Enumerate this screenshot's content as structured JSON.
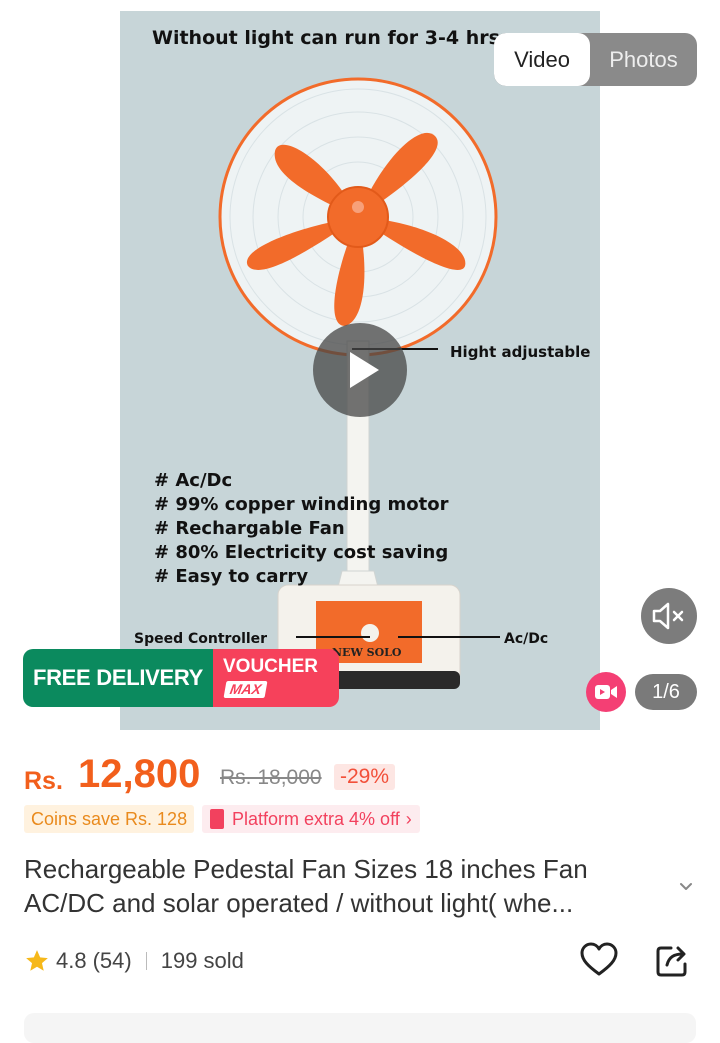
{
  "media": {
    "photo": {
      "caption_top": "Without light can run for 3-4 hrs",
      "hight_label": "Hight adjustable",
      "features": [
        "# Ac/Dc",
        "# 99% copper winding motor",
        "# Rechargable Fan",
        "# 80% Electricity cost saving",
        "# Easy to carry"
      ],
      "speed_label": "Speed Controller",
      "acdc_label": "Ac/Dc",
      "brand_on_base": "NEW SOLO"
    },
    "tabs": {
      "video_label": "Video",
      "photos_label": "Photos",
      "active": "Video"
    },
    "free_delivery_label": "FREE DELIVERY",
    "voucher_label": "VOUCHER",
    "voucher_badge": "MAX",
    "counter": "1/6",
    "icons": {
      "play": "play-icon",
      "mute": "speaker-muted-icon",
      "video": "video-camera-icon"
    },
    "colors": {
      "photo_bg": "#c7d5d8",
      "fan_orange": "#f26b2a",
      "free_delivery": "#0b8a5e",
      "voucher": "#f6415b"
    }
  },
  "pricing": {
    "currency": "Rs.",
    "price": "12,800",
    "original_price": "Rs. 18,000",
    "discount": "-29%",
    "coins_note": "Coins save Rs. 128",
    "platform_offer": "Platform extra 4% off",
    "colors": {
      "price": "#f25f1c",
      "discount": "#f2503a"
    }
  },
  "product": {
    "title_line1": "Rechargeable Pedestal Fan Sizes 18 inches  Fan",
    "title_line2": "AC/DC and solar operated / without light( whe..."
  },
  "rating": {
    "score": "4.8",
    "count": "(54)",
    "sold": "199 sold",
    "icons": {
      "star": "star-icon",
      "wishlist": "heart-icon",
      "share": "share-icon"
    }
  }
}
